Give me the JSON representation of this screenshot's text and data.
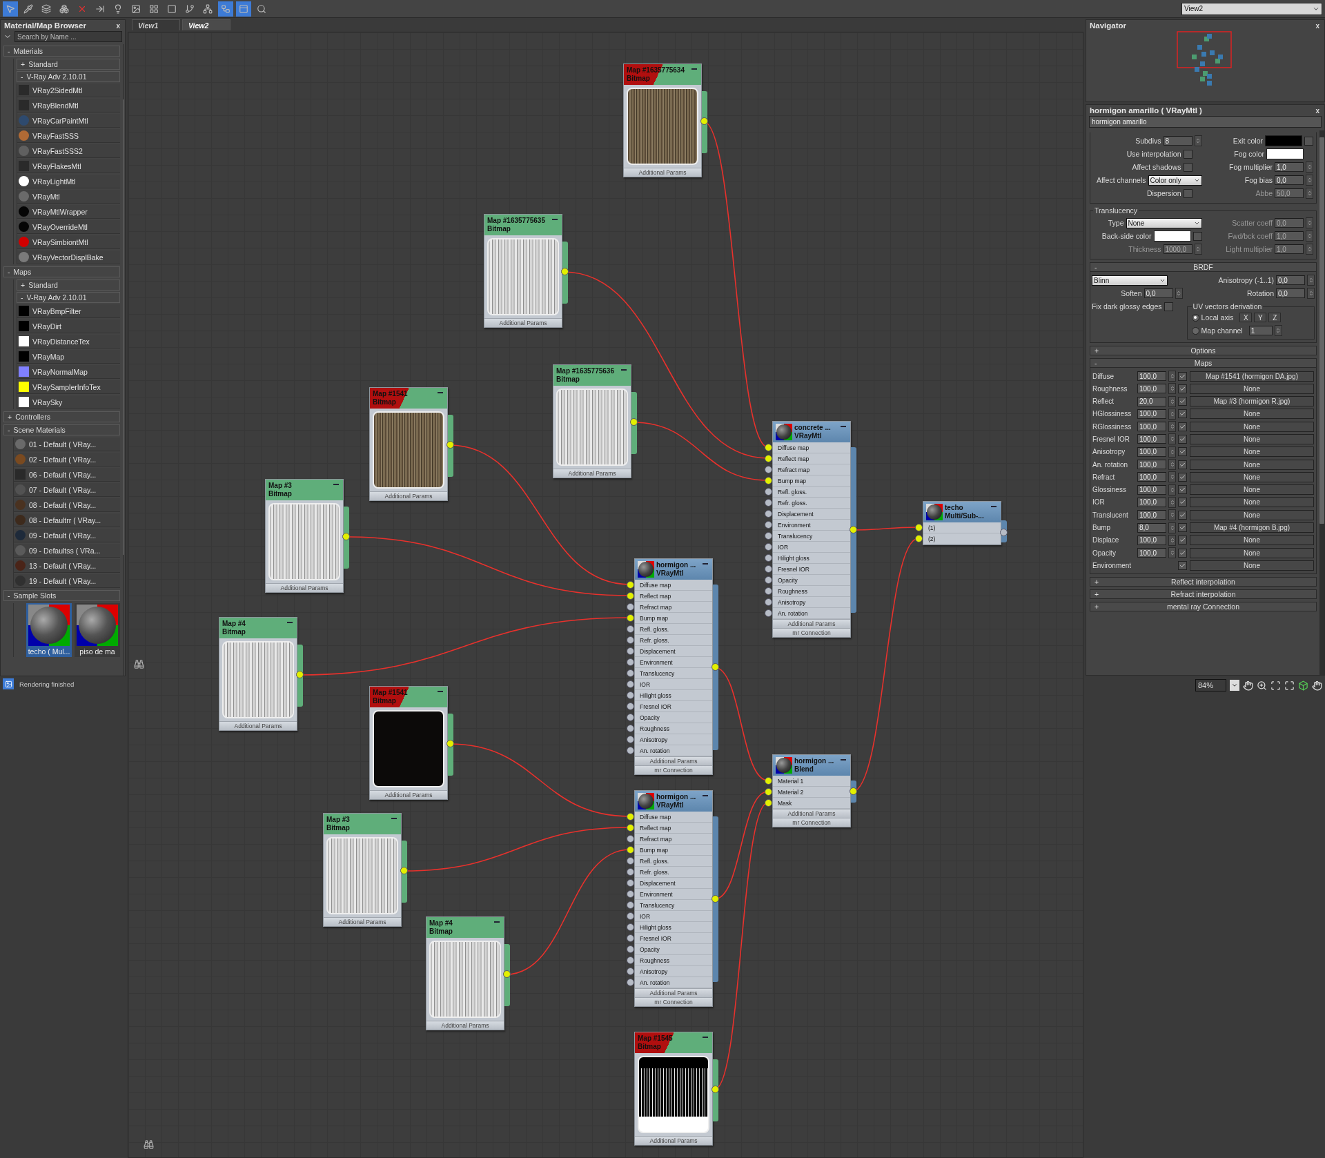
{
  "toolbar": {
    "tools": [
      {
        "selected": true
      },
      {
        "selected": false
      },
      {
        "selected": false
      },
      {
        "selected": false
      },
      {
        "selected": false
      },
      {
        "selected": false
      },
      {
        "selected": false
      },
      {
        "selected": false
      },
      {
        "selected": false
      },
      {
        "selected": false
      },
      {
        "selected": false
      },
      {
        "selected": false
      },
      {
        "selected": true
      },
      {
        "selected": true
      },
      {
        "selected": false
      }
    ],
    "view_select": "View2"
  },
  "browser": {
    "title": "Material/Map Browser",
    "close": "x",
    "search": {
      "placeholder": "Search by Name ..."
    },
    "groups": [
      {
        "toggle": "-",
        "label": "Materials",
        "children": [
          {
            "toggle": "+",
            "label": "Standard"
          },
          {
            "toggle": "-",
            "label": "V-Ray Adv 2.10.01",
            "items": [
              {
                "label": "VRay2SidedMtl",
                "kind": "blank"
              },
              {
                "label": "VRayBlendMtl",
                "kind": "blank"
              },
              {
                "label": "VRayCarPaintMtl",
                "kind": "sphere",
                "color": "#2e4a6e"
              },
              {
                "label": "VRayFastSSS",
                "kind": "sphere",
                "color": "#b06a35"
              },
              {
                "label": "VRayFastSSS2",
                "kind": "sphere",
                "color": "#606060"
              },
              {
                "label": "VRayFlakesMtl",
                "kind": "blank"
              },
              {
                "label": "VRayLightMtl",
                "kind": "sphere",
                "color": "#ffffff"
              },
              {
                "label": "VRayMtl",
                "kind": "sphere",
                "color": "#6a6a6a"
              },
              {
                "label": "VRayMtlWrapper",
                "kind": "sphere",
                "color": "#050505"
              },
              {
                "label": "VRayOverrideMtl",
                "kind": "sphere",
                "color": "#050505"
              },
              {
                "label": "VRaySimbiontMtl",
                "kind": "sphere",
                "color": "#d00000"
              },
              {
                "label": "VRayVectorDisplBake",
                "kind": "sphere",
                "color": "#7a7a7a"
              }
            ]
          }
        ]
      },
      {
        "toggle": "-",
        "label": "Maps",
        "children": [
          {
            "toggle": "+",
            "label": "Standard"
          },
          {
            "toggle": "-",
            "label": "V-Ray Adv 2.10.01",
            "items": [
              {
                "label": "VRayBmpFilter",
                "kind": "square",
                "color": "#000000"
              },
              {
                "label": "VRayDirt",
                "kind": "square",
                "color": "#000000"
              },
              {
                "label": "VRayDistanceTex",
                "kind": "square",
                "color": "#ffffff"
              },
              {
                "label": "VRayMap",
                "kind": "square",
                "color": "#000000"
              },
              {
                "label": "VRayNormalMap",
                "kind": "square",
                "color": "#8080ff"
              },
              {
                "label": "VRaySamplerInfoTex",
                "kind": "square",
                "color": "#ffff00"
              },
              {
                "label": "VRaySky",
                "kind": "square",
                "color": "#ffffff"
              }
            ]
          }
        ]
      },
      {
        "toggle": "+",
        "label": "Controllers"
      },
      {
        "toggle": "-",
        "label": "Scene Materials",
        "items": [
          {
            "label": "01 - Default  ( VRay...",
            "kind": "sphere",
            "color": "#6a6a6a"
          },
          {
            "label": "02 - Default  ( VRay...",
            "kind": "sphere",
            "color": "#7a4a20"
          },
          {
            "label": "06 - Default  ( VRay...",
            "kind": "blank"
          },
          {
            "label": "07 - Default  ( VRay...",
            "kind": "sphere",
            "color": "#525252"
          },
          {
            "label": "08 - Default  ( VRay...",
            "kind": "sphere",
            "color": "#4a3220"
          },
          {
            "label": "08 - Defaultrr  ( VRay...",
            "kind": "sphere",
            "color": "#3d2a1c"
          },
          {
            "label": "09 - Default  ( VRay...",
            "kind": "sphere",
            "color": "#1e2a3a"
          },
          {
            "label": "09 - Defaultss  ( VRa...",
            "kind": "sphere",
            "color": "#5a5a5a"
          },
          {
            "label": "13 - Default  ( VRay...",
            "kind": "sphere",
            "color": "#4a2418"
          },
          {
            "label": "19 - Default  ( VRay...",
            "kind": "sphere",
            "color": "#303030"
          }
        ]
      },
      {
        "toggle": "-",
        "label": "Sample Slots",
        "slots": [
          {
            "label": "techo  ( Mul...",
            "selected": true
          },
          {
            "label": "piso de ma",
            "selected": false
          }
        ]
      }
    ]
  },
  "status_bar": {
    "text": "Rendering finished"
  },
  "view_tabs": [
    {
      "label": "View1",
      "selected": false
    },
    {
      "label": "View2",
      "selected": true
    }
  ],
  "nodes": [
    {
      "kind": "bitmap",
      "title": "Map #1635775634",
      "subtitle": "Bitmap",
      "flagged": true,
      "footer": "Additional Params"
    },
    {
      "kind": "bitmap",
      "title": "Map #1635775635",
      "subtitle": "Bitmap",
      "flagged": false,
      "footer": "Additional Params"
    },
    {
      "kind": "bitmap",
      "title": "Map #1635775636",
      "subtitle": "Bitmap",
      "flagged": false,
      "footer": "Additional Params"
    },
    {
      "kind": "bitmap",
      "title": "Map #1541",
      "subtitle": "Bitmap",
      "flagged": true,
      "footer": "Additional Params"
    },
    {
      "kind": "bitmap",
      "title": "Map #3",
      "subtitle": "Bitmap",
      "flagged": false,
      "footer": "Additional Params"
    },
    {
      "kind": "bitmap",
      "title": "Map #4",
      "subtitle": "Bitmap",
      "flagged": false,
      "footer": "Additional Params"
    },
    {
      "kind": "bitmap",
      "title": "Map #1541",
      "subtitle": "Bitmap",
      "flagged": true,
      "footer": "Additional Params"
    },
    {
      "kind": "bitmap",
      "title": "Map #3",
      "subtitle": "Bitmap",
      "flagged": false,
      "footer": "Additional Params"
    },
    {
      "kind": "bitmap",
      "title": "Map #4",
      "subtitle": "Bitmap",
      "flagged": false,
      "footer": "Additional Params"
    },
    {
      "kind": "bitmap",
      "title": "Map #1545",
      "subtitle": "Bitmap",
      "flagged": true,
      "footer": "Additional Params"
    },
    {
      "kind": "material",
      "title": "concrete ...",
      "subtitle": "VRayMtl",
      "footers": [
        "Additional Params",
        "mr Connection"
      ],
      "slots": [
        {
          "label": "Diffuse map",
          "connected": true
        },
        {
          "label": "Reflect map",
          "connected": true
        },
        {
          "label": "Refract map",
          "connected": false
        },
        {
          "label": "Bump map",
          "connected": true
        },
        {
          "label": "Refl. gloss.",
          "connected": false
        },
        {
          "label": "Refr. gloss.",
          "connected": false
        },
        {
          "label": "Displacement",
          "connected": false
        },
        {
          "label": "Environment",
          "connected": false
        },
        {
          "label": "Translucency",
          "connected": false
        },
        {
          "label": "IOR",
          "connected": false
        },
        {
          "label": "Hilight gloss",
          "connected": false
        },
        {
          "label": "Fresnel IOR",
          "connected": false
        },
        {
          "label": "Opacity",
          "connected": false
        },
        {
          "label": "Roughness",
          "connected": false
        },
        {
          "label": "Anisotropy",
          "connected": false
        },
        {
          "label": "An. rotation",
          "connected": false
        }
      ]
    },
    {
      "kind": "material",
      "title": "hormigon ...",
      "subtitle": "VRayMtl",
      "footers": [
        "Additional Params",
        "mr Connection"
      ],
      "slots": [
        {
          "label": "Diffuse map",
          "connected": true
        },
        {
          "label": "Reflect map",
          "connected": true
        },
        {
          "label": "Refract map",
          "connected": false
        },
        {
          "label": "Bump map",
          "connected": true
        },
        {
          "label": "Refl. gloss.",
          "connected": false
        },
        {
          "label": "Refr. gloss.",
          "connected": false
        },
        {
          "label": "Displacement",
          "connected": false
        },
        {
          "label": "Environment",
          "connected": false
        },
        {
          "label": "Translucency",
          "connected": false
        },
        {
          "label": "IOR",
          "connected": false
        },
        {
          "label": "Hilight gloss",
          "connected": false
        },
        {
          "label": "Fresnel IOR",
          "connected": false
        },
        {
          "label": "Opacity",
          "connected": false
        },
        {
          "label": "Roughness",
          "connected": false
        },
        {
          "label": "Anisotropy",
          "connected": false
        },
        {
          "label": "An. rotation",
          "connected": false
        }
      ]
    },
    {
      "kind": "material",
      "title": "hormigon ...",
      "subtitle": "VRayMtl",
      "footers": [
        "Additional Params",
        "mr Connection"
      ],
      "slots": [
        {
          "label": "Diffuse map",
          "connected": true
        },
        {
          "label": "Reflect map",
          "connected": true
        },
        {
          "label": "Refract map",
          "connected": false
        },
        {
          "label": "Bump map",
          "connected": true
        },
        {
          "label": "Refl. gloss.",
          "connected": false
        },
        {
          "label": "Refr. gloss.",
          "connected": false
        },
        {
          "label": "Displacement",
          "connected": false
        },
        {
          "label": "Environment",
          "connected": false
        },
        {
          "label": "Translucency",
          "connected": false
        },
        {
          "label": "IOR",
          "connected": false
        },
        {
          "label": "Hilight gloss",
          "connected": false
        },
        {
          "label": "Fresnel IOR",
          "connected": false
        },
        {
          "label": "Opacity",
          "connected": false
        },
        {
          "label": "Roughness",
          "connected": false
        },
        {
          "label": "Anisotropy",
          "connected": false
        },
        {
          "label": "An. rotation",
          "connected": false
        }
      ]
    },
    {
      "kind": "material",
      "title": "hormigon ...",
      "subtitle": "Blend",
      "footers": [
        "Additional Params",
        "mr Connection"
      ],
      "slots": [
        {
          "label": "Material 1",
          "connected": true
        },
        {
          "label": "Material 2",
          "connected": true
        },
        {
          "label": "Mask",
          "connected": true
        }
      ]
    },
    {
      "kind": "material",
      "title": "techo",
      "subtitle": "Multi/Sub-...",
      "slots": [
        {
          "label": "(1)",
          "connected": true
        },
        {
          "label": "(2)",
          "connected": true
        }
      ]
    }
  ],
  "navigator": {
    "title": "Navigator",
    "close": "x"
  },
  "material_panel": {
    "title": "hormigon amarillo  ( VRayMtl )",
    "close": "x",
    "name": "hormigon amarillo",
    "refraction": {
      "left": [
        {
          "kind": "spinner",
          "label": "Subdivs",
          "value": "8"
        },
        {
          "kind": "checkbox",
          "label": "Use interpolation",
          "checked": false
        },
        {
          "kind": "checkbox",
          "label": "Affect shadows",
          "checked": false
        },
        {
          "kind": "dropdown",
          "label": "Affect channels",
          "value": "Color only"
        },
        {
          "kind": "checkbox",
          "label": "Dispersion",
          "checked": false
        }
      ],
      "right": [
        {
          "kind": "swatch",
          "label": "Exit color",
          "color": "#000000",
          "checked": false
        },
        {
          "kind": "swatch",
          "label": "Fog color",
          "color": "#ffffff"
        },
        {
          "kind": "spinner",
          "label": "Fog multiplier",
          "value": "1,0"
        },
        {
          "kind": "spinner",
          "label": "Fog bias",
          "value": "0,0"
        },
        {
          "kind": "spinner",
          "label": "Abbe",
          "value": "50,0",
          "disabled": true
        }
      ]
    },
    "translucency": {
      "title": "Translucency",
      "left": [
        {
          "kind": "dropdown",
          "label": "Type",
          "value": "None"
        },
        {
          "kind": "swatch",
          "label": "Back-side color",
          "color": "#ffffff",
          "checked": false
        },
        {
          "kind": "spinner",
          "label": "Thickness",
          "value": "1000,0",
          "disabled": true
        }
      ],
      "right": [
        {
          "kind": "spinner",
          "label": "Scatter coeff",
          "value": "0,0",
          "disabled": true
        },
        {
          "kind": "spinner",
          "label": "Fwd/bck coeff",
          "value": "1,0",
          "disabled": true
        },
        {
          "kind": "spinner",
          "label": "Light multiplier",
          "value": "1,0",
          "disabled": true
        }
      ]
    },
    "brdf": {
      "toggle": "-",
      "title": "BRDF",
      "left": [
        {
          "kind": "dropdown",
          "value": "Blinn"
        },
        {
          "kind": "spinner",
          "label": "Soften",
          "value": "0,0"
        },
        {
          "kind": "checkbox",
          "label": "Fix dark glossy edges",
          "checked": false
        }
      ],
      "right": [
        {
          "kind": "spinner",
          "label": "Anisotropy (-1..1)",
          "value": "0,0"
        },
        {
          "kind": "spinner",
          "label": "Rotation",
          "value": "0,0"
        }
      ],
      "uv": {
        "title": "UV vectors derivation",
        "options": [
          {
            "label": "Local axis",
            "selected": true,
            "axes": [
              "X",
              "Y",
              "Z"
            ]
          },
          {
            "label": "Map channel",
            "selected": false,
            "value": "1"
          }
        ]
      }
    },
    "options": {
      "toggle": "+",
      "title": "Options"
    },
    "maps": {
      "toggle": "-",
      "title": "Maps",
      "rows": [
        {
          "label": "Diffuse",
          "amount": "100,0",
          "enabled": true,
          "map": "Map #1541 (hormigon DA.jpg)"
        },
        {
          "label": "Roughness",
          "amount": "100,0",
          "enabled": true,
          "map": "None"
        },
        {
          "label": "Reflect",
          "amount": "20,0",
          "enabled": true,
          "map": "Map #3 (hormigon R.jpg)"
        },
        {
          "label": "HGlossiness",
          "amount": "100,0",
          "enabled": true,
          "map": "None"
        },
        {
          "label": "RGlossiness",
          "amount": "100,0",
          "enabled": true,
          "map": "None"
        },
        {
          "label": "Fresnel IOR",
          "amount": "100,0",
          "enabled": true,
          "map": "None"
        },
        {
          "label": "Anisotropy",
          "amount": "100,0",
          "enabled": true,
          "map": "None"
        },
        {
          "label": "An. rotation",
          "amount": "100,0",
          "enabled": true,
          "map": "None"
        },
        {
          "label": "Refract",
          "amount": "100,0",
          "enabled": true,
          "map": "None"
        },
        {
          "label": "Glossiness",
          "amount": "100,0",
          "enabled": true,
          "map": "None"
        },
        {
          "label": "IOR",
          "amount": "100,0",
          "enabled": true,
          "map": "None"
        },
        {
          "label": "Translucent",
          "amount": "100,0",
          "enabled": true,
          "map": "None"
        },
        {
          "label": "Bump",
          "amount": "8,0",
          "enabled": true,
          "map": "Map #4 (hormigon B.jpg)"
        },
        {
          "label": "Displace",
          "amount": "100,0",
          "enabled": true,
          "map": "None"
        },
        {
          "label": "Opacity",
          "amount": "100,0",
          "enabled": true,
          "map": "None"
        },
        {
          "label": "Environment",
          "enabled": true,
          "map": "None"
        }
      ]
    },
    "rollouts": [
      {
        "toggle": "+",
        "title": "Reflect interpolation"
      },
      {
        "toggle": "+",
        "title": "Refract interpolation"
      },
      {
        "toggle": "+",
        "title": "mental ray Connection"
      }
    ]
  },
  "zoom": {
    "value": "84%"
  }
}
